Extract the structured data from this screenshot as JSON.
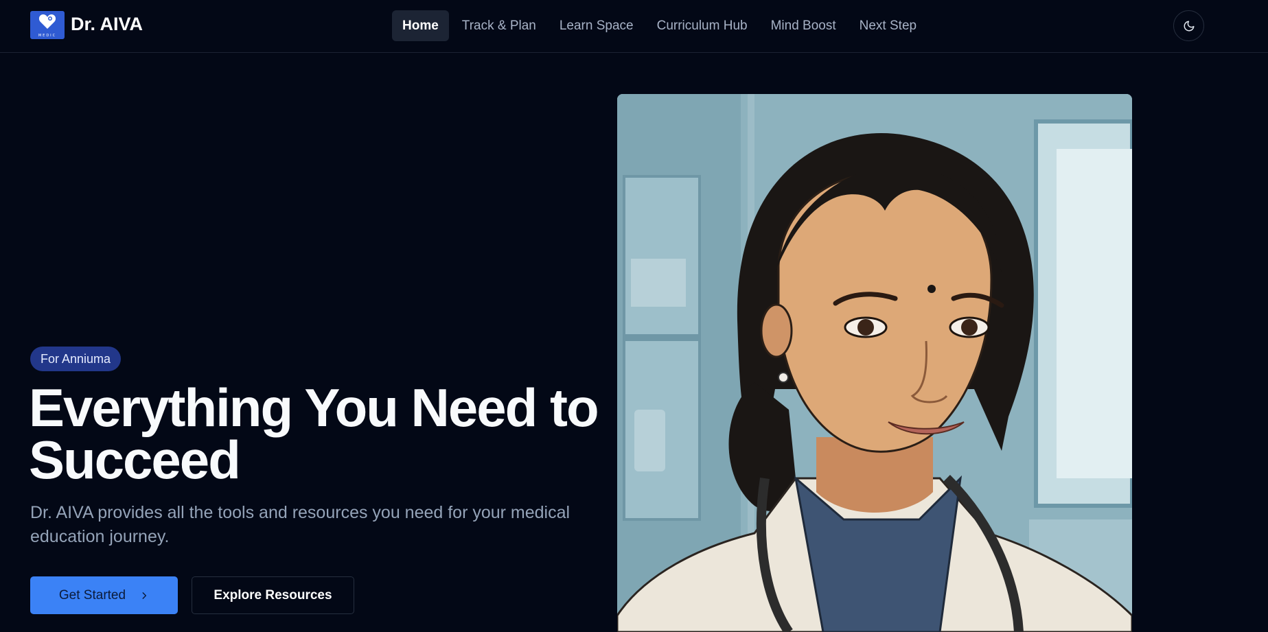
{
  "header": {
    "brand": "Dr. AIVA",
    "logo_caption": "MEDIC",
    "logo_icon": "heart-icon",
    "nav": [
      {
        "label": "Home",
        "active": true
      },
      {
        "label": "Track & Plan",
        "active": false
      },
      {
        "label": "Learn Space",
        "active": false
      },
      {
        "label": "Curriculum Hub",
        "active": false
      },
      {
        "label": "Mind Boost",
        "active": false
      },
      {
        "label": "Next Step",
        "active": false
      }
    ],
    "theme_icon": "moon-icon"
  },
  "hero": {
    "badge": "For Anniuma",
    "headline": "Everything You Need to Succeed",
    "subtext": "Dr. AIVA provides all the tools and resources you need for your medical education journey.",
    "primary_button": "Get Started",
    "primary_button_icon": "chevron-right-icon",
    "secondary_button": "Explore Resources",
    "image": "doctor-illustration"
  },
  "colors": {
    "background": "#030816",
    "accent": "#3b82f6",
    "badge": "#22378a",
    "logo": "#2f5bd3"
  }
}
